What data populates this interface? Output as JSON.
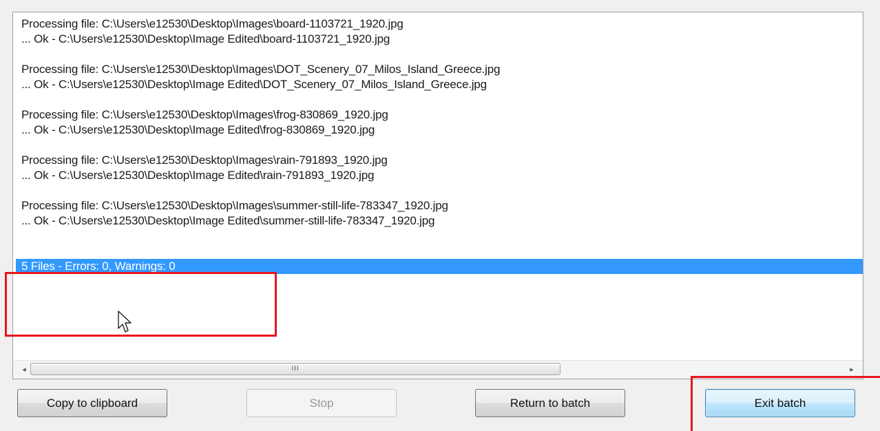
{
  "log": {
    "lines": [
      "Processing file: C:\\Users\\e12530\\Desktop\\Images\\board-1103721_1920.jpg",
      "... Ok - C:\\Users\\e12530\\Desktop\\Image Edited\\board-1103721_1920.jpg",
      "",
      "Processing file: C:\\Users\\e12530\\Desktop\\Images\\DOT_Scenery_07_Milos_Island_Greece.jpg",
      "... Ok - C:\\Users\\e12530\\Desktop\\Image Edited\\DOT_Scenery_07_Milos_Island_Greece.jpg",
      "",
      "Processing file: C:\\Users\\e12530\\Desktop\\Images\\frog-830869_1920.jpg",
      "... Ok - C:\\Users\\e12530\\Desktop\\Image Edited\\frog-830869_1920.jpg",
      "",
      "Processing file: C:\\Users\\e12530\\Desktop\\Images\\rain-791893_1920.jpg",
      "... Ok - C:\\Users\\e12530\\Desktop\\Image Edited\\rain-791893_1920.jpg",
      "",
      "Processing file: C:\\Users\\e12530\\Desktop\\Images\\summer-still-life-783347_1920.jpg",
      "... Ok - C:\\Users\\e12530\\Desktop\\Image Edited\\summer-still-life-783347_1920.jpg",
      "",
      "",
      "5 Files - Errors: 0, Warnings: 0"
    ],
    "selected_index": 16
  },
  "scrollbar": {
    "left_arrow": "◂",
    "right_arrow": "▸",
    "grip": "III"
  },
  "buttons": {
    "copy": "Copy to clipboard",
    "stop": "Stop",
    "return": "Return to batch",
    "exit": "Exit batch"
  },
  "colors": {
    "selection": "#3399ff",
    "highlight": "#e8151b"
  },
  "icons": {
    "cursor": "mouse-pointer-icon"
  }
}
